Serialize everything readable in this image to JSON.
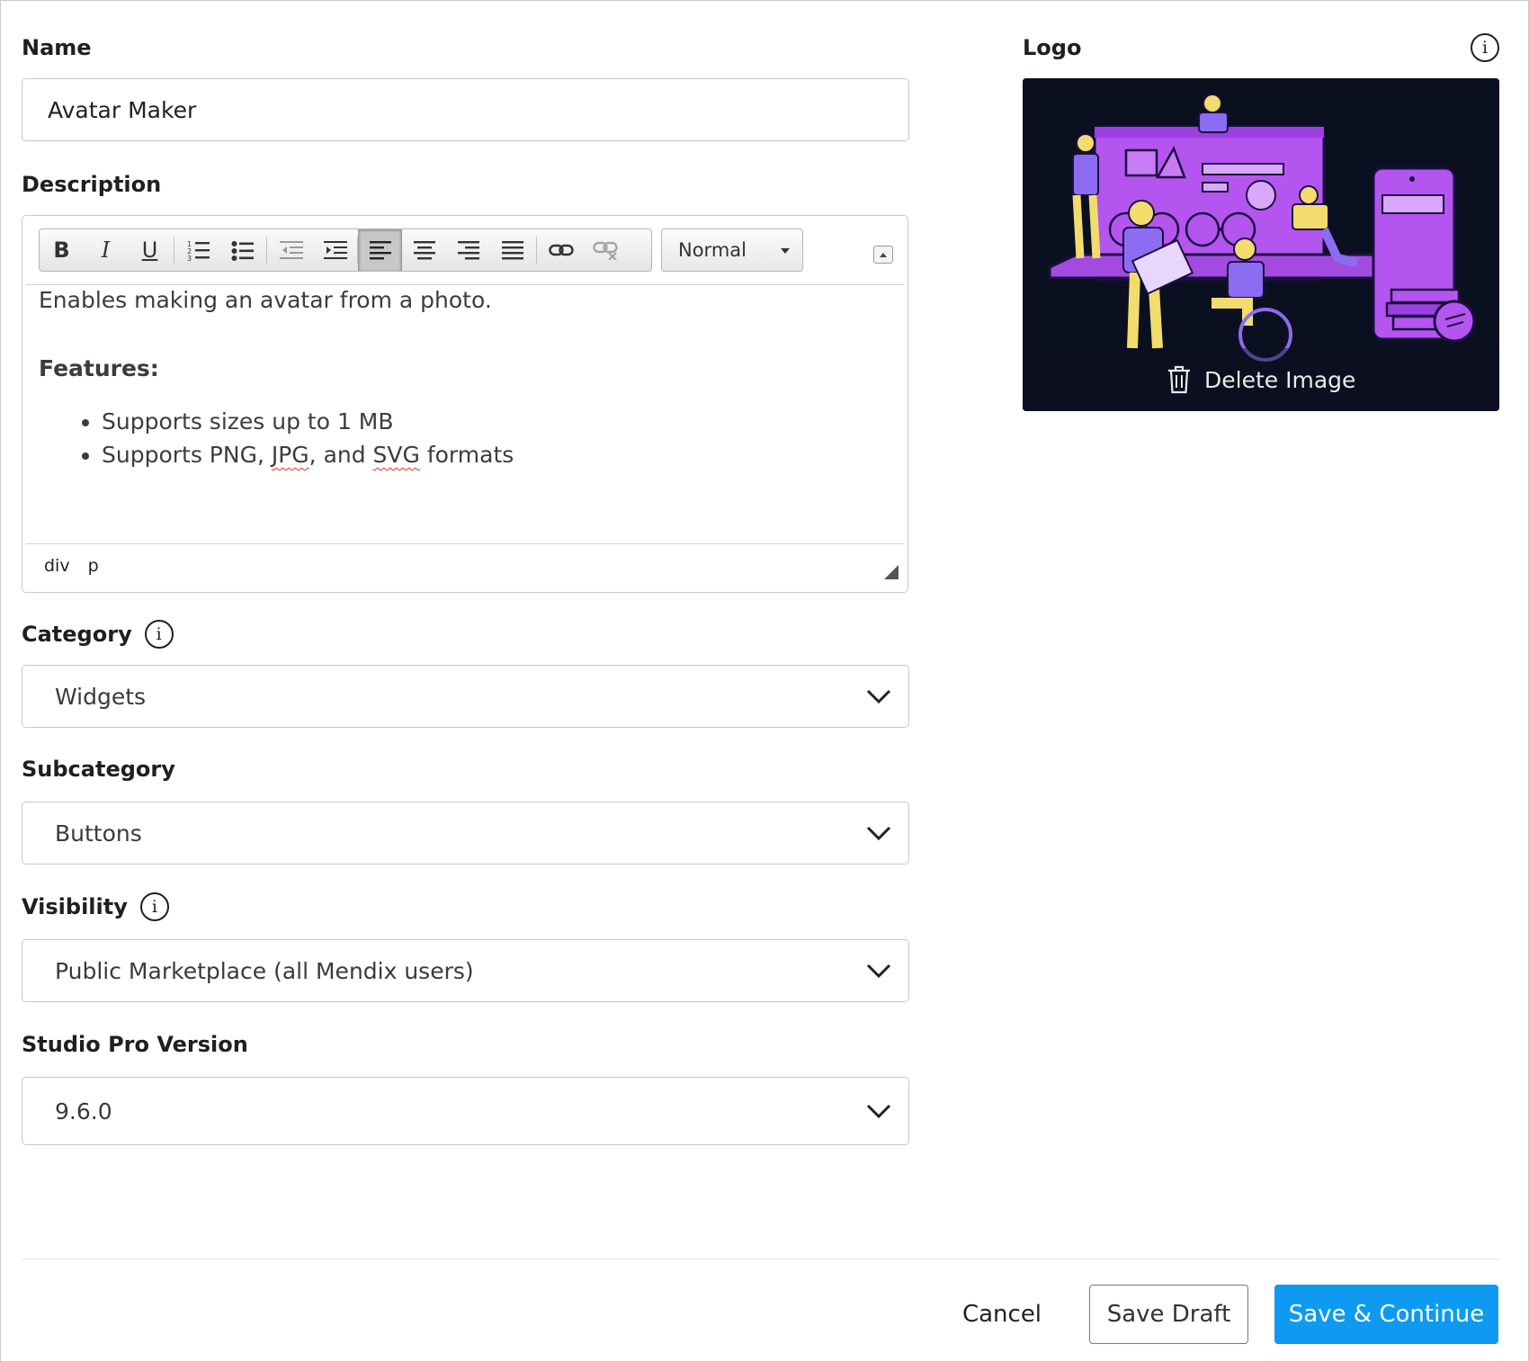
{
  "form": {
    "name_label": "Name",
    "name_value": "Avatar Maker",
    "description_label": "Description",
    "category_label": "Category",
    "category_value": "Widgets",
    "subcategory_label": "Subcategory",
    "subcategory_value": "Buttons",
    "visibility_label": "Visibility",
    "visibility_value": "Public Marketplace (all Mendix users)",
    "version_label": "Studio Pro Version",
    "version_value": "9.6.0"
  },
  "editor": {
    "format_select": "Normal",
    "paragraph": "Enables making an avatar from a photo.",
    "features_heading": "Features:",
    "bullet1": "Supports sizes up to 1 MB",
    "bullet2_a": "Supports PNG, ",
    "bullet2_jpg": "JPG",
    "bullet2_b": ", and ",
    "bullet2_svg": "SVG",
    "bullet2_c": " formats",
    "path_div": "div",
    "path_p": "p",
    "toolbar": {
      "bold": "B",
      "italic": "I",
      "underline": "U"
    }
  },
  "logo": {
    "label": "Logo",
    "delete_label": "Delete Image"
  },
  "footer": {
    "cancel": "Cancel",
    "save_draft": "Save Draft",
    "save_continue": "Save & Continue"
  },
  "colors": {
    "primary": "#0d9af0",
    "illustration_purple": "#b455ef",
    "illustration_yellow": "#f2dc6e",
    "illustration_bg": "#0b1020"
  }
}
